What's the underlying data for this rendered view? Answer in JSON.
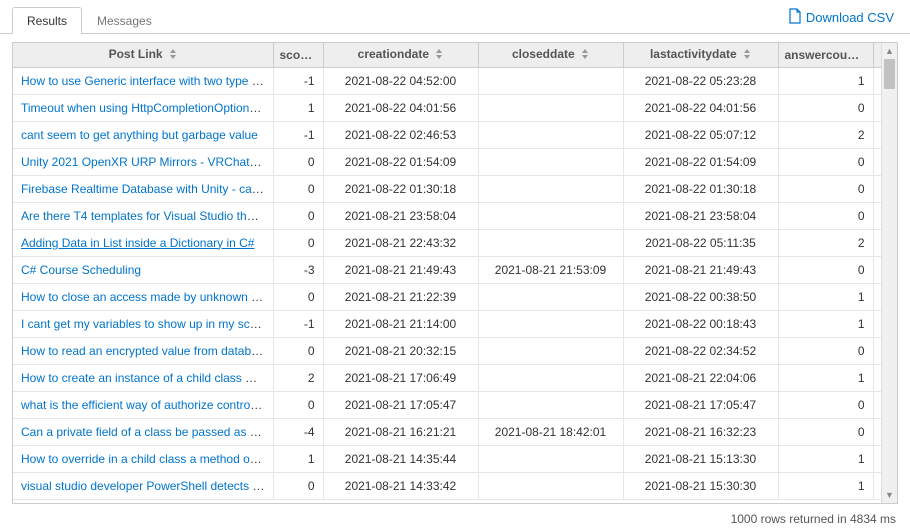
{
  "tabs": {
    "results": "Results",
    "messages": "Messages"
  },
  "download": "Download CSV",
  "headers": {
    "postlink": "Post Link",
    "score": "scor…",
    "creation": "creationdate",
    "closed": "closeddate",
    "lastact": "lastactivitydate",
    "answer": "answercoun…"
  },
  "rows": [
    {
      "postlink": "How to use Generic interface with two type in…",
      "score": -1,
      "creation": "2021-08-22 04:52:00",
      "closed": "",
      "lastact": "2021-08-22 05:23:28",
      "answers": 1
    },
    {
      "postlink": "Timeout when using HttpCompletionOption.R…",
      "score": 1,
      "creation": "2021-08-22 04:01:56",
      "closed": "",
      "lastact": "2021-08-22 04:01:56",
      "answers": 0
    },
    {
      "postlink": "cant seem to get anything but garbage value",
      "score": -1,
      "creation": "2021-08-22 02:46:53",
      "closed": "",
      "lastact": "2021-08-22 05:07:12",
      "answers": 2
    },
    {
      "postlink": "Unity 2021 OpenXR URP Mirrors - VRChat S…",
      "score": 0,
      "creation": "2021-08-22 01:54:09",
      "closed": "",
      "lastact": "2021-08-22 01:54:09",
      "answers": 0
    },
    {
      "postlink": "Firebase Realtime Database with Unity - can'…",
      "score": 0,
      "creation": "2021-08-22 01:30:18",
      "closed": "",
      "lastact": "2021-08-22 01:30:18",
      "answers": 0
    },
    {
      "postlink": "Are there T4 templates for Visual Studio that …",
      "score": 0,
      "creation": "2021-08-21 23:58:04",
      "closed": "",
      "lastact": "2021-08-21 23:58:04",
      "answers": 0
    },
    {
      "postlink": "Adding Data in List inside a Dictionary in C#",
      "hover": true,
      "score": 0,
      "creation": "2021-08-21 22:43:32",
      "closed": "",
      "lastact": "2021-08-22 05:11:35",
      "answers": 2
    },
    {
      "postlink": "C# Course Scheduling",
      "score": -3,
      "creation": "2021-08-21 21:49:43",
      "closed": "2021-08-21 21:53:09",
      "lastact": "2021-08-21 21:49:43",
      "answers": 0
    },
    {
      "postlink": "How to close an access made by unknown pr…",
      "score": 0,
      "creation": "2021-08-21 21:22:39",
      "closed": "",
      "lastact": "2021-08-22 00:38:50",
      "answers": 1
    },
    {
      "postlink": "I cant get my variables to show up in my scrip…",
      "score": -1,
      "creation": "2021-08-21 21:14:00",
      "closed": "",
      "lastact": "2021-08-22 00:18:43",
      "answers": 1
    },
    {
      "postlink": "How to read an encrypted value from databa…",
      "score": 0,
      "creation": "2021-08-21 20:32:15",
      "closed": "",
      "lastact": "2021-08-22 02:34:52",
      "answers": 0
    },
    {
      "postlink": "How to create an instance of a child class wit…",
      "score": 2,
      "creation": "2021-08-21 17:06:49",
      "closed": "",
      "lastact": "2021-08-21 22:04:06",
      "answers": 1
    },
    {
      "postlink": "what is the efficient way of authorize controlle…",
      "score": 0,
      "creation": "2021-08-21 17:05:47",
      "closed": "",
      "lastact": "2021-08-21 17:05:47",
      "answers": 0
    },
    {
      "postlink": "Can a private field of a class be passed as a …",
      "score": -4,
      "creation": "2021-08-21 16:21:21",
      "closed": "2021-08-21 18:42:01",
      "lastact": "2021-08-21 16:32:23",
      "answers": 0
    },
    {
      "postlink": "How to override in a child class a method of a…",
      "score": 1,
      "creation": "2021-08-21 14:35:44",
      "closed": "",
      "lastact": "2021-08-21 15:13:30",
      "answers": 1
    },
    {
      "postlink": "visual studio developer PowerShell detects o…",
      "score": 0,
      "creation": "2021-08-21 14:33:42",
      "closed": "",
      "lastact": "2021-08-21 15:30:30",
      "answers": 1
    }
  ],
  "status": "1000 rows returned in 4834 ms"
}
